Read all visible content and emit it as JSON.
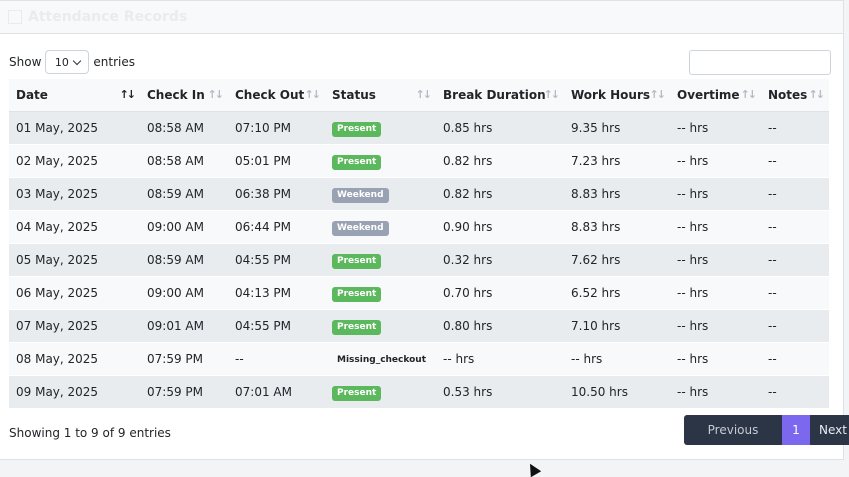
{
  "card": {
    "title": "Attendance Records"
  },
  "controls": {
    "show_label": "Show",
    "page_length": "10",
    "entries_label": "entries",
    "search_placeholder": ""
  },
  "table": {
    "headers": [
      "Date",
      "Check In",
      "Check Out",
      "Status",
      "Break Duration",
      "Work Hours",
      "Overtime",
      "Notes"
    ],
    "sorted_column": "Date",
    "rows": [
      {
        "date": "01 May, 2025",
        "check_in": "08:58 AM",
        "check_out": "07:10 PM",
        "status": "Present",
        "status_type": "present",
        "break": "0.85 hrs",
        "work": "9.35 hrs",
        "overtime": "-- hrs",
        "notes": "--"
      },
      {
        "date": "02 May, 2025",
        "check_in": "08:58 AM",
        "check_out": "05:01 PM",
        "status": "Present",
        "status_type": "present",
        "break": "0.82 hrs",
        "work": "7.23 hrs",
        "overtime": "-- hrs",
        "notes": "--"
      },
      {
        "date": "03 May, 2025",
        "check_in": "08:59 AM",
        "check_out": "06:38 PM",
        "status": "Weekend",
        "status_type": "weekend",
        "break": "0.82 hrs",
        "work": "8.83 hrs",
        "overtime": "-- hrs",
        "notes": "--"
      },
      {
        "date": "04 May, 2025",
        "check_in": "09:00 AM",
        "check_out": "06:44 PM",
        "status": "Weekend",
        "status_type": "weekend",
        "break": "0.90 hrs",
        "work": "8.83 hrs",
        "overtime": "-- hrs",
        "notes": "--"
      },
      {
        "date": "05 May, 2025",
        "check_in": "08:59 AM",
        "check_out": "04:55 PM",
        "status": "Present",
        "status_type": "present",
        "break": "0.32 hrs",
        "work": "7.62 hrs",
        "overtime": "-- hrs",
        "notes": "--"
      },
      {
        "date": "06 May, 2025",
        "check_in": "09:00 AM",
        "check_out": "04:13 PM",
        "status": "Present",
        "status_type": "present",
        "break": "0.70 hrs",
        "work": "6.52 hrs",
        "overtime": "-- hrs",
        "notes": "--"
      },
      {
        "date": "07 May, 2025",
        "check_in": "09:01 AM",
        "check_out": "04:55 PM",
        "status": "Present",
        "status_type": "present",
        "break": "0.80 hrs",
        "work": "7.10 hrs",
        "overtime": "-- hrs",
        "notes": "--"
      },
      {
        "date": "08 May, 2025",
        "check_in": "07:59 PM",
        "check_out": "--",
        "status": "Missing_checkout",
        "status_type": "missing",
        "break": "-- hrs",
        "work": "-- hrs",
        "overtime": "-- hrs",
        "notes": "--"
      },
      {
        "date": "09 May, 2025",
        "check_in": "07:59 PM",
        "check_out": "07:01 AM",
        "status": "Present",
        "status_type": "present",
        "break": "0.53 hrs",
        "work": "10.50 hrs",
        "overtime": "-- hrs",
        "notes": "--"
      }
    ]
  },
  "footer": {
    "info": "Showing 1 to 9 of 9 entries",
    "prev_label": "Previous",
    "page_label": "1",
    "next_label": "Next"
  },
  "colors": {
    "accent": "#7b68ee",
    "present": "#5cb85c",
    "weekend": "#98a2b3",
    "pager_bg": "#2b3545"
  },
  "icons": {
    "sort_active": "sort-asc-icon",
    "sort_inactive": "sort-both-icon",
    "header": "calendar-icon"
  }
}
